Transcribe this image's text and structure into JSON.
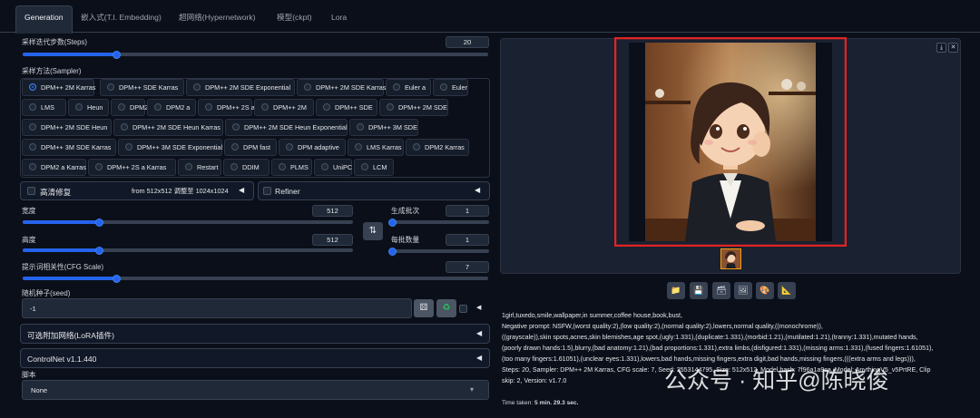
{
  "tabs": [
    "Generation",
    "嵌入式(T.I. Embedding)",
    "超网络(Hypernetwork)",
    "模型(ckpt)",
    "Lora"
  ],
  "steps": {
    "label": "采样迭代步数(Steps)",
    "value": "20",
    "fraction": 0.2
  },
  "sampler": {
    "label": "采样方法(Sampler)",
    "selected": "DPM++ 2M Karras",
    "options": [
      "DPM++ 2M Karras",
      "DPM++ SDE Karras",
      "DPM++ 2M SDE Exponential",
      "DPM++ 2M SDE Karras",
      "Euler a",
      "Euler",
      "LMS",
      "Heun",
      "DPM2",
      "DPM2 a",
      "DPM++ 2S a",
      "DPM++ 2M",
      "DPM++ SDE",
      "DPM++ 2M SDE",
      "DPM++ 2M SDE Heun",
      "DPM++ 2M SDE Heun Karras",
      "DPM++ 2M SDE Heun Exponential",
      "DPM++ 3M SDE",
      "DPM++ 3M SDE Karras",
      "DPM++ 3M SDE Exponential",
      "DPM fast",
      "DPM adaptive",
      "LMS Karras",
      "DPM2 Karras",
      "DPM2 a Karras",
      "DPM++ 2S a Karras",
      "Restart",
      "DDIM",
      "PLMS",
      "UniPC",
      "LCM"
    ]
  },
  "hires": {
    "label": "高清修复",
    "info": "from 512x512 调整至 1024x1024"
  },
  "refiner": {
    "label": "Refiner"
  },
  "width": {
    "label": "宽度",
    "value": "512",
    "fraction": 0.23
  },
  "height": {
    "label": "高度",
    "value": "512",
    "fraction": 0.23
  },
  "batch_count": {
    "label": "生成批次",
    "value": "1",
    "fraction": 0.0
  },
  "batch_size": {
    "label": "每批数量",
    "value": "1",
    "fraction": 0.0
  },
  "cfg": {
    "label": "提示词相关性(CFG Scale)",
    "value": "7",
    "fraction": 0.2
  },
  "seed": {
    "label": "随机种子(seed)",
    "value": "-1"
  },
  "lora": {
    "label": "可选附加网络(LoRA插件)"
  },
  "controlnet": {
    "label": "ControlNet v1.1.440"
  },
  "script": {
    "label": "脚本",
    "value": "None"
  },
  "info": {
    "lines": [
      "1girl,tuxedo,smile,wallpaper,in summer,coffee house,book,bust,",
      "Negative prompt: NSFW,(worst quality:2),(low quality:2),(normal quality:2),lowers,normal quality,((monochrome)),",
      "((grayscale)),skin spots,acnes,skin blemishes,age spot,(ugly:1.331),(duplicate:1.331),(morbid:1.21),(mutilated:1.21),(tranny:1.331),mutated hands,",
      "(poorly drawn hands:1.5),blurry,(bad anatomy:1.21),(bad proportions:1.331),extra limbs,(disfigured:1.331),(missing arms:1.331),(fused fingers:1.61051),",
      "(too many fingers:1.61051),(unclear eyes:1.331),lowers,bad hands,missing fingers,extra digit,bad hands,missing fingers,(((extra arms and legs))),",
      "Steps: 20, Sampler: DPM++ 2M Karras, CFG scale: 7, Seed: 3553144795, Size: 512x512, Model hash: 7f96a1a9ca, Model: AnythingV5_v5PrtRE, Clip",
      "skip: 2, Version: v1.7.0"
    ],
    "time_label": "Time taken:",
    "time_value": "5 min. 29.3 sec."
  },
  "watermark": "公众号 · 知乎@陈晓俊",
  "colors": {
    "background": "#0b0f19",
    "accent": "#2563eb",
    "highlight": "#e02424"
  }
}
